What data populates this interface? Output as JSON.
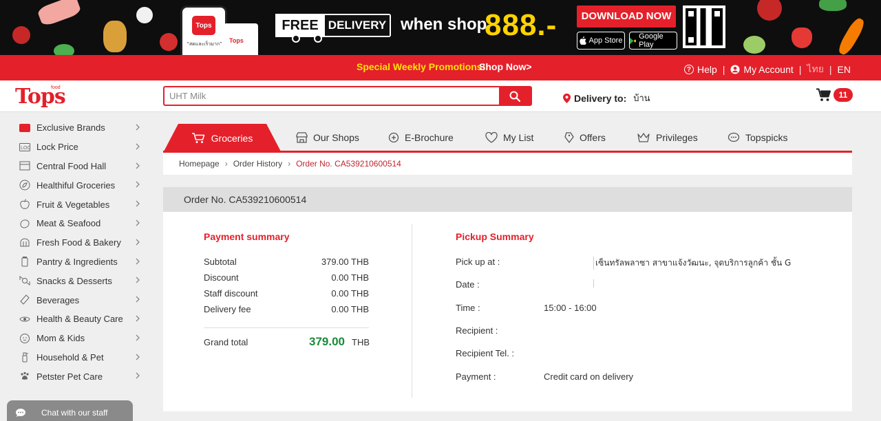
{
  "banner": {
    "phone_logo": "Tops",
    "phone_text": "“สดและเร็วมาก”",
    "bag_logo": "Tops",
    "free": "FREE",
    "delivery": "DELIVERY",
    "when_shop": "when shop",
    "amount": "888.-",
    "download": "DOWNLOAD NOW",
    "app_store": "App Store",
    "google_play": "Google Play"
  },
  "promo": {
    "text": "Special Weekly Promotions!",
    "shop_now": "Shop Now>"
  },
  "top_links": {
    "help": "Help",
    "account": "My Account",
    "thai": "ไทย",
    "en": "EN"
  },
  "header": {
    "logo": "Tops",
    "logo_sup": "food",
    "search_value": "",
    "search_placeholder": "UHT Milk",
    "delivery_label": "Delivery to:",
    "delivery_address": "บ้าน",
    "cart_count": "11"
  },
  "sidebar": {
    "items": [
      {
        "label": "Exclusive Brands",
        "icon": "tops-brand-icon"
      },
      {
        "label": "Lock Price",
        "icon": "lock-price-icon"
      },
      {
        "label": "Central Food Hall",
        "icon": "food-hall-icon"
      },
      {
        "label": "Healthiful Groceries",
        "icon": "leaf-icon"
      },
      {
        "label": "Fruit & Vegetables",
        "icon": "apple-icon"
      },
      {
        "label": "Meat & Seafood",
        "icon": "meat-icon"
      },
      {
        "label": "Fresh Food & Bakery",
        "icon": "bread-icon"
      },
      {
        "label": "Pantry & Ingredients",
        "icon": "pantry-icon"
      },
      {
        "label": "Snacks & Desserts",
        "icon": "candy-icon"
      },
      {
        "label": "Beverages",
        "icon": "bottle-icon"
      },
      {
        "label": "Health & Beauty Care",
        "icon": "eye-icon"
      },
      {
        "label": "Mom & Kids",
        "icon": "baby-icon"
      },
      {
        "label": "Household & Pet",
        "icon": "spray-icon"
      },
      {
        "label": "Petster Pet Care",
        "icon": "pet-icon"
      }
    ]
  },
  "tabs": {
    "groceries": "Groceries",
    "our_shops": "Our Shops",
    "ebrochure": "E-Brochure",
    "my_list": "My List",
    "offers": "Offers",
    "privileges": "Privileges",
    "topspicks": "Topspicks"
  },
  "breadcrumb": {
    "home": "Homepage",
    "history": "Order History",
    "current": "Order No. CA539210600514"
  },
  "order": {
    "title": "Order No. CA539210600514",
    "payment_title": "Payment summary",
    "subtotal_label": "Subtotal",
    "subtotal_value": "379.00 THB",
    "discount_label": "Discount",
    "discount_value": "0.00 THB",
    "staff_label": "Staff discount",
    "staff_value": "0.00 THB",
    "delivery_label": "Delivery fee",
    "delivery_value": "0.00 THB",
    "grand_label": "Grand total",
    "grand_value": "379.00",
    "grand_currency": "THB",
    "pickup_title": "Pickup Summary",
    "pickup_at_label": "Pick up at :",
    "pickup_at_value": "เซ็นทรัลพลาซา สาขาแจ้งวัฒนะ, จุดบริการลูกค้า ชั้น G",
    "date_label": "Date :",
    "time_label": "Time :",
    "time_value": "15:00 - 16:00",
    "recipient_label": "Recipient :",
    "recipient_tel_label": "Recipient Tel. :",
    "payment_label": "Payment :",
    "payment_value": "Credit card on delivery"
  },
  "chat": {
    "label": "Chat with our staff"
  },
  "colors": {
    "brand_red": "#e4202a",
    "promo_yellow": "#ffe400",
    "grand_green": "#1a8a38"
  }
}
